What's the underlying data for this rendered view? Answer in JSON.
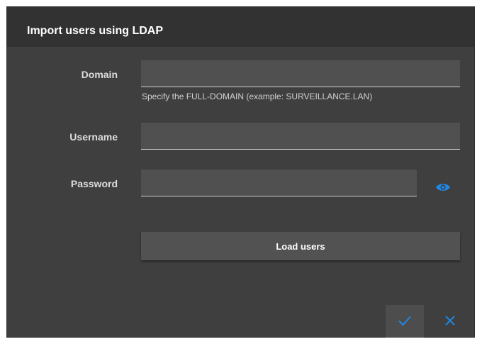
{
  "dialog": {
    "title": "Import users using LDAP"
  },
  "form": {
    "domain": {
      "label": "Domain",
      "value": "",
      "hint": "Specify the FULL-DOMAIN (example: SURVEILLANCE.LAN)"
    },
    "username": {
      "label": "Username",
      "value": ""
    },
    "password": {
      "label": "Password",
      "value": "",
      "toggle_icon": "eye-icon"
    }
  },
  "actions": {
    "load_users_label": "Load users",
    "confirm_icon": "check-icon",
    "cancel_icon": "close-icon"
  },
  "colors": {
    "accent": "#1e88e5",
    "dialog_bg": "#3f3f3f",
    "titlebar_bg": "#323232",
    "field_bg": "#505050"
  }
}
